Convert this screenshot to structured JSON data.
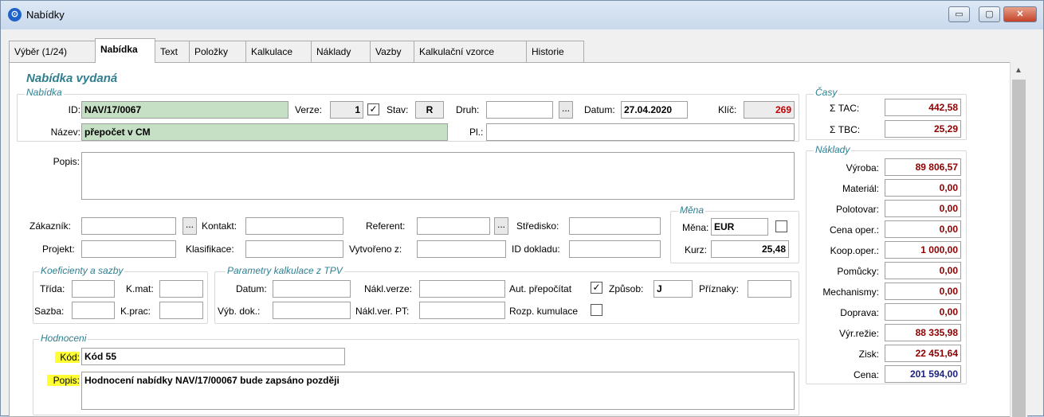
{
  "window": {
    "title": "Nabídky",
    "icon": "app-logo-icon",
    "minimize": "▭",
    "maximize": "▢",
    "close": "✕"
  },
  "tabs": [
    {
      "label": "Výběr (1/24)"
    },
    {
      "label": "Nabídka",
      "active": true
    },
    {
      "label": "Text"
    },
    {
      "label": "Položky"
    },
    {
      "label": "Kalkulace"
    },
    {
      "label": "Náklady"
    },
    {
      "label": "Vazby"
    },
    {
      "label": "Kalkulační vzorce"
    },
    {
      "label": "Historie"
    }
  ],
  "section_title": "Nabídka vydaná",
  "offer": {
    "group_label": "Nabídka",
    "id_label": "ID:",
    "id": "NAV/17/0067",
    "version_label": "Verze:",
    "version": "1",
    "version_check": "✓",
    "status_label": "Stav:",
    "status": "R",
    "type_label": "Druh:",
    "type": "",
    "type_btn": "...",
    "date_label": "Datum:",
    "date": "27.04.2020",
    "key_label": "Klíč:",
    "key": "269",
    "name_label": "Název:",
    "name": "přepočet v CM",
    "pl_label": "Pl.:",
    "pl": "",
    "desc_label": "Popis:",
    "desc": ""
  },
  "parties": {
    "customer_label": "Zákazník:",
    "customer": "",
    "customer_btn": "...",
    "contact_label": "Kontakt:",
    "contact": "",
    "referent_label": "Referent:",
    "referent": "",
    "referent_btn": "...",
    "center_label": "Středisko:",
    "center": "",
    "project_label": "Projekt:",
    "project": "",
    "classification_label": "Klasifikace:",
    "classification": "",
    "created_from_label": "Vytvořeno z:",
    "created_from": "",
    "doc_id_label": "ID dokladu:",
    "doc_id": ""
  },
  "currency": {
    "group_label": "Měna",
    "currency_label": "Měna:",
    "currency": "EUR",
    "checked": "",
    "rate_label": "Kurz:",
    "rate": "25,48"
  },
  "coefficients": {
    "group_label": "Koeficienty a sazby",
    "class_label": "Třída:",
    "class": "",
    "kmat_label": "K.mat:",
    "kmat": "",
    "rate_label": "Sazba:",
    "rate": "",
    "kprac_label": "K.prac:",
    "kprac": ""
  },
  "calc_params": {
    "group_label": "Parametry kalkulace z TPV",
    "date_label": "Datum:",
    "date": "",
    "cost_version_label": "Nákl.verze:",
    "cost_version": "",
    "auto_recalc_label": "Aut. přepočítat",
    "auto_recalc": "✓",
    "method_label": "Způsob:",
    "method": "J",
    "flags_label": "Příznaky:",
    "flags": "",
    "doc_select_label": "Výb. dok.:",
    "doc_select": "",
    "cost_version_pt_label": "Nákl.ver. PT:",
    "cost_version_pt": "",
    "cumulation_label": "Rozp. kumulace",
    "cumulation": ""
  },
  "evaluation": {
    "group_label": "Hodnoceni",
    "code_label": "Kód:",
    "code": "Kód 55",
    "desc_label": "Popis:",
    "desc": "Hodnocení nabídky NAV/17/00067 bude zapsáno později"
  },
  "times": {
    "group_label": "Časy",
    "tac_label": "Σ  TAC:",
    "tac": "442,58",
    "tbc_label": "Σ  TBC:",
    "tbc": "25,29"
  },
  "costs": {
    "group_label": "Náklady",
    "rows": [
      {
        "label": "Výroba:",
        "value": "89 806,57"
      },
      {
        "label": "Materiál:",
        "value": "0,00"
      },
      {
        "label": "Polotovar:",
        "value": "0,00"
      },
      {
        "label": "Cena oper.:",
        "value": "0,00"
      },
      {
        "label": "Koop.oper.:",
        "value": "1 000,00"
      },
      {
        "label": "Pomůcky:",
        "value": "0,00"
      },
      {
        "label": "Mechanismy:",
        "value": "0,00"
      },
      {
        "label": "Doprava:",
        "value": "0,00"
      },
      {
        "label": "Výr.režie:",
        "value": "88 335,98"
      },
      {
        "label": "Zisk:",
        "value": "22 451,64"
      },
      {
        "label": "Cena:",
        "value": "201 594,00"
      }
    ]
  }
}
